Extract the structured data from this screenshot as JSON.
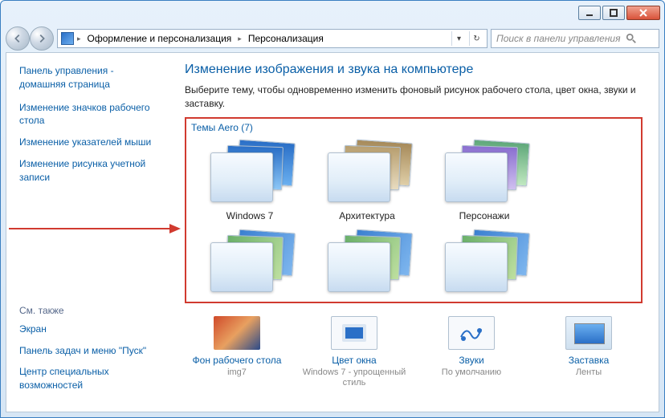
{
  "titlebar": {},
  "breadcrumb": {
    "item1": "Оформление и персонализация",
    "item2": "Персонализация"
  },
  "search": {
    "placeholder": "Поиск в панели управления"
  },
  "sidebar": {
    "home": "Панель управления - домашняя страница",
    "links": [
      "Изменение значков рабочего стола",
      "Изменение указателей мыши",
      "Изменение рисунка учетной записи"
    ],
    "see_also_title": "См. также",
    "see_also": [
      "Экран",
      "Панель задач и меню \"Пуск\"",
      "Центр специальных возможностей"
    ]
  },
  "main": {
    "title": "Изменение изображения и звука на компьютере",
    "desc": "Выберите тему, чтобы одновременно изменить фоновый рисунок рабочего стола, цвет окна, звуки и заставку.",
    "group_name": "Темы Aero (7)",
    "themes": [
      {
        "name": "Windows 7",
        "cls": "th-windows"
      },
      {
        "name": "Архитектура",
        "cls": "th-arch"
      },
      {
        "name": "Персонажи",
        "cls": "th-char"
      },
      {
        "name": "",
        "cls": "th-a"
      },
      {
        "name": "",
        "cls": "th-b"
      },
      {
        "name": "",
        "cls": "th-c"
      }
    ],
    "bottom": {
      "bg": {
        "label": "Фон рабочего стола",
        "sub": "img7"
      },
      "color": {
        "label": "Цвет окна",
        "sub": "Windows 7 - упрощенный стиль"
      },
      "sound": {
        "label": "Звуки",
        "sub": "По умолчанию"
      },
      "saver": {
        "label": "Заставка",
        "sub": "Ленты"
      }
    }
  }
}
